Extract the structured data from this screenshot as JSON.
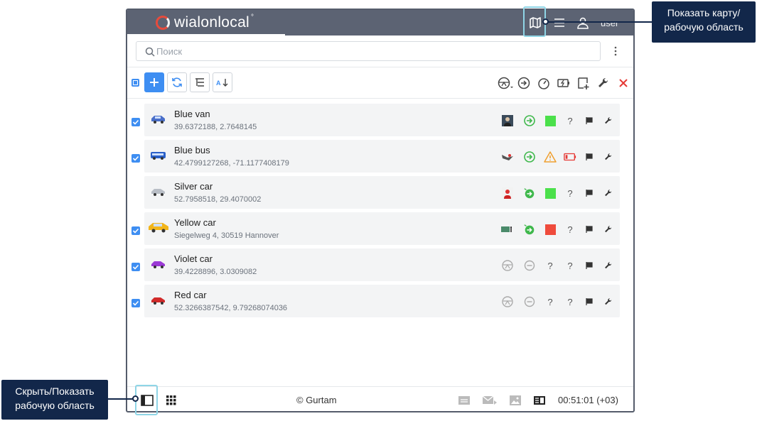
{
  "app": {
    "logo_text": "wialonlocal",
    "logo_sup": "°",
    "user": "user"
  },
  "search": {
    "placeholder": "Поиск",
    "value": ""
  },
  "units": [
    {
      "name": "Blue van",
      "coords": "39.6372188, 2.7648145",
      "checked": true,
      "car_color": "#4a6fc9",
      "status_color": "#4be04b"
    },
    {
      "name": "Blue bus",
      "coords": "42.4799127268, -71.1177408179",
      "checked": true,
      "car_color": "#2b60c8",
      "status_color": ""
    },
    {
      "name": "Silver car",
      "coords": "52.7958518, 29.4070002",
      "checked": false,
      "car_color": "#b9bec6",
      "status_color": "#4be04b"
    },
    {
      "name": "Yellow car",
      "coords": "Siegelweg 4, 30519 Hannover",
      "checked": true,
      "car_color": "#f2b51a",
      "status_color": "#ef4b3c"
    },
    {
      "name": "Violet car",
      "coords": "39.4228896, 3.0309082",
      "checked": true,
      "car_color": "#9b3ad6",
      "status_color": ""
    },
    {
      "name": "Red car",
      "coords": "52.3266387542, 9.79268074036",
      "checked": true,
      "car_color": "#d12a2a",
      "status_color": ""
    }
  ],
  "cells": {
    "unknown": "?"
  },
  "footer": {
    "copyright": "© Gurtam",
    "clock": "00:51:01 (+03)"
  },
  "callouts": {
    "map": "Показать карту/\nрабочую область",
    "panel": "Скрыть/Показать\nрабочую область"
  },
  "colors": {
    "accent": "#3e8ef2",
    "header": "#5c6373",
    "callout_bg": "#12274a",
    "highlight": "#8fd5e6",
    "green": "#3fb84c",
    "warning": "#f0a030",
    "danger": "#e53935"
  }
}
